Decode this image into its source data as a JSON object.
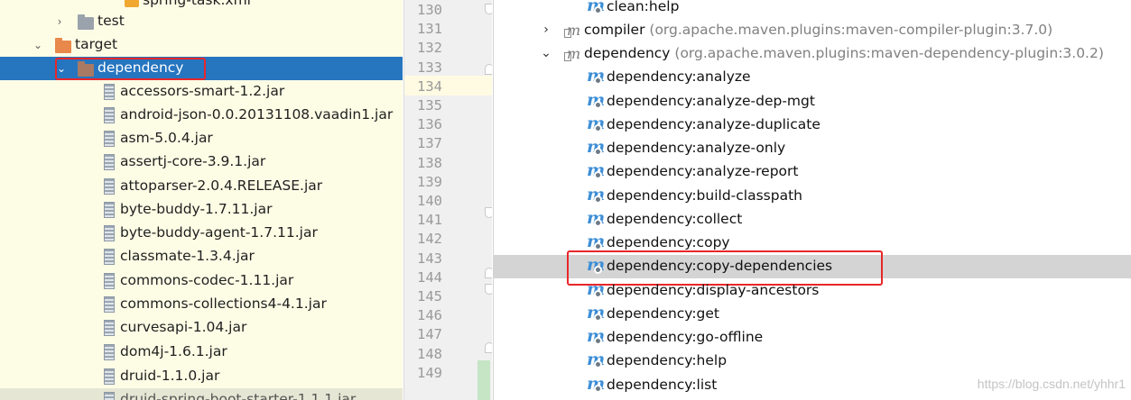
{
  "project_tree": {
    "partial_top_item": "spring-task.xml",
    "items": [
      {
        "label": "test",
        "type": "folder",
        "expanded": false
      },
      {
        "label": "target",
        "type": "folder",
        "expanded": true,
        "folder_color": "#e8884a"
      },
      {
        "label": "dependency",
        "type": "folder",
        "expanded": true,
        "selected": true,
        "highlighted": true
      },
      {
        "label": "accessors-smart-1.2.jar",
        "type": "jar"
      },
      {
        "label": "android-json-0.0.20131108.vaadin1.jar",
        "type": "jar"
      },
      {
        "label": "asm-5.0.4.jar",
        "type": "jar"
      },
      {
        "label": "assertj-core-3.9.1.jar",
        "type": "jar"
      },
      {
        "label": "attoparser-2.0.4.RELEASE.jar",
        "type": "jar"
      },
      {
        "label": "byte-buddy-1.7.11.jar",
        "type": "jar"
      },
      {
        "label": "byte-buddy-agent-1.7.11.jar",
        "type": "jar"
      },
      {
        "label": "classmate-1.3.4.jar",
        "type": "jar"
      },
      {
        "label": "commons-codec-1.11.jar",
        "type": "jar"
      },
      {
        "label": "commons-collections4-4.1.jar",
        "type": "jar"
      },
      {
        "label": "curvesapi-1.04.jar",
        "type": "jar"
      },
      {
        "label": "dom4j-1.6.1.jar",
        "type": "jar"
      },
      {
        "label": "druid-1.1.0.jar",
        "type": "jar"
      },
      {
        "label": "druid-spring-boot-starter-1.1.1.jar",
        "type": "jar",
        "partial": true
      }
    ]
  },
  "gutter": {
    "line_numbers": [
      "130",
      "131",
      "132",
      "133",
      "134",
      "135",
      "136",
      "137",
      "138",
      "139",
      "140",
      "141",
      "142",
      "143",
      "144",
      "145",
      "146",
      "147",
      "148",
      "149"
    ],
    "current_line": "134"
  },
  "maven_panel": {
    "items": [
      {
        "kind": "goal",
        "label": "clean:help"
      },
      {
        "kind": "plugin",
        "label": "compiler",
        "desc": "(org.apache.maven.plugins:maven-compiler-plugin:3.7.0)",
        "expanded": false
      },
      {
        "kind": "plugin",
        "label": "dependency",
        "desc": "(org.apache.maven.plugins:maven-dependency-plugin:3.0.2)",
        "expanded": true
      },
      {
        "kind": "goal",
        "label": "dependency:analyze"
      },
      {
        "kind": "goal",
        "label": "dependency:analyze-dep-mgt"
      },
      {
        "kind": "goal",
        "label": "dependency:analyze-duplicate"
      },
      {
        "kind": "goal",
        "label": "dependency:analyze-only"
      },
      {
        "kind": "goal",
        "label": "dependency:analyze-report"
      },
      {
        "kind": "goal",
        "label": "dependency:build-classpath"
      },
      {
        "kind": "goal",
        "label": "dependency:collect"
      },
      {
        "kind": "goal",
        "label": "dependency:copy"
      },
      {
        "kind": "goal",
        "label": "dependency:copy-dependencies",
        "selected": true,
        "highlighted": true
      },
      {
        "kind": "goal",
        "label": "dependency:display-ancestors"
      },
      {
        "kind": "goal",
        "label": "dependency:get"
      },
      {
        "kind": "goal",
        "label": "dependency:go-offline"
      },
      {
        "kind": "goal",
        "label": "dependency:help"
      },
      {
        "kind": "goal",
        "label": "dependency:list"
      }
    ],
    "watermark": "https://blog.csdn.net/yhhr1"
  },
  "colors": {
    "tree_background": "#fdfde6",
    "selection_blue": "#2675bf",
    "highlight_red": "#e8262a",
    "gutter_background": "#f0f0f0",
    "maven_selection": "#d4d4d4",
    "maven_icon_blue": "#3d8ed6"
  }
}
